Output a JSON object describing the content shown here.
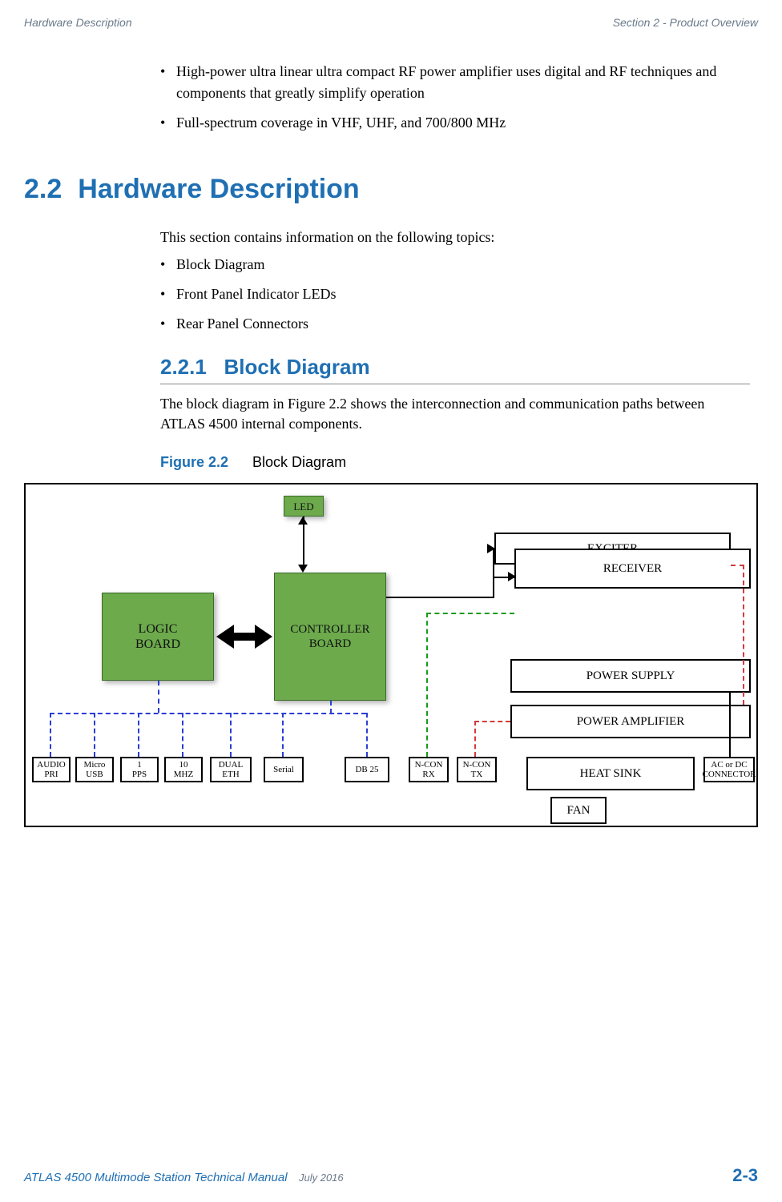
{
  "header": {
    "left": "Hardware Description",
    "right": "Section 2 - Product Overview"
  },
  "top_bullets": [
    "High-power ultra linear ultra compact RF power amplifier uses digital and RF techniques and components that greatly simplify operation",
    "Full-spectrum coverage in VHF, UHF, and 700/800 MHz"
  ],
  "section": {
    "number": "2.2",
    "title": "Hardware Description",
    "intro": "This section contains information on the following topics:",
    "topics": [
      "Block Diagram",
      "Front Panel Indicator LEDs",
      "Rear Panel Connectors"
    ]
  },
  "subsection": {
    "number": "2.2.1",
    "title": "Block Diagram",
    "paragraph": "The block diagram in Figure 2.2 shows the interconnection and communication paths between ATLAS 4500 internal components."
  },
  "figure": {
    "number": "Figure 2.2",
    "caption": "Block Diagram"
  },
  "diagram": {
    "green_blocks": {
      "logic": "LOGIC\nBOARD",
      "controller": "CONTROLLER\nBOARD",
      "led": "LED"
    },
    "white_blocks": {
      "exciter": "EXCITER",
      "receiver": "RECEIVER",
      "power_supply": "POWER SUPPLY",
      "power_amplifier": "POWER AMPLIFIER",
      "heat_sink": "HEAT SINK",
      "fan": "FAN"
    },
    "connectors": [
      "AUDIO\nPRI",
      "Micro\nUSB",
      "1\nPPS",
      "10\nMHZ",
      "DUAL\nETH",
      "Serial",
      "DB 25",
      "N-CON\nRX",
      "N-CON\nTX",
      "AC or DC\nCONNECTOR"
    ]
  },
  "footer": {
    "manual": "ATLAS 4500 Multimode Station Technical Manual",
    "date": "July 2016",
    "page": "2-3"
  }
}
